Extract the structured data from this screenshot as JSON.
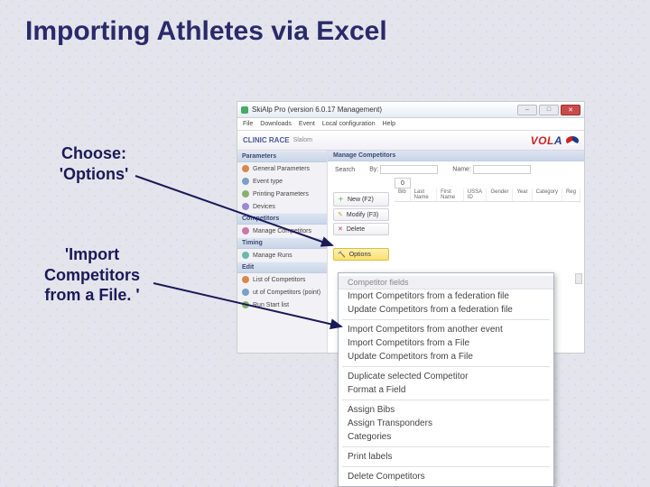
{
  "slide": {
    "title": "Importing Athletes via Excel",
    "callout1_l1": "Choose:",
    "callout1_l2": "'Options'",
    "callout2_l1": "'Import",
    "callout2_l2": "Competitors",
    "callout2_l3": "from a File. '"
  },
  "app": {
    "title": "SkiAlp Pro (version 6.0.17 Management)",
    "menus": [
      "File",
      "Downloads",
      "Event",
      "Local configuration",
      "Help"
    ],
    "header": {
      "badge": "CLINIC RACE",
      "sub": "Slalom",
      "brand_v": "VOL",
      "brand_a": "A"
    },
    "sidebar": {
      "parameters": {
        "title": "Parameters",
        "items": [
          "General Parameters",
          "Event type",
          "Printing Parameters",
          "Devices"
        ]
      },
      "competitors": {
        "title": "Competitors",
        "items": [
          "Manage Competitors"
        ]
      },
      "timing": {
        "title": "Timing",
        "items": [
          "Manage Runs"
        ]
      },
      "edit": {
        "title": "Edit",
        "items": [
          "List of Competitors",
          "ut of Competitors (point)",
          "Run Start list"
        ]
      }
    },
    "toolbar": {
      "panel": "Manage Competitors",
      "search": "Search",
      "by": "By:",
      "name": "Name:",
      "page": "0",
      "new": "New (F2)",
      "modify": "Modify (F3)",
      "delete": "Delete",
      "options": "Options"
    },
    "grid_cols": [
      "Bib",
      "Last Name",
      "First Name",
      "USSA ID",
      "Gender",
      "Year",
      "Category",
      "Reg"
    ]
  },
  "dropdown": {
    "head": "Competitor fields",
    "items_a": [
      "Import Competitors from a federation file",
      "Update Competitors from a federation file"
    ],
    "items_b": [
      "Import Competitors from another event",
      "Import Competitors from a File",
      "Update Competitors from a File"
    ],
    "items_c": [
      "Duplicate selected Competitor",
      "Format a Field"
    ],
    "items_d": [
      "Assign Bibs",
      "Assign Transponders",
      "Categories"
    ],
    "items_e": [
      "Print labels"
    ],
    "items_f": [
      "Delete Competitors"
    ]
  },
  "colors": {
    "i1": "#d88848",
    "i2": "#7aa0c8",
    "i3": "#88b070",
    "i4": "#9a8ad0",
    "i5": "#c878a8",
    "i6": "#6ab8b0"
  }
}
